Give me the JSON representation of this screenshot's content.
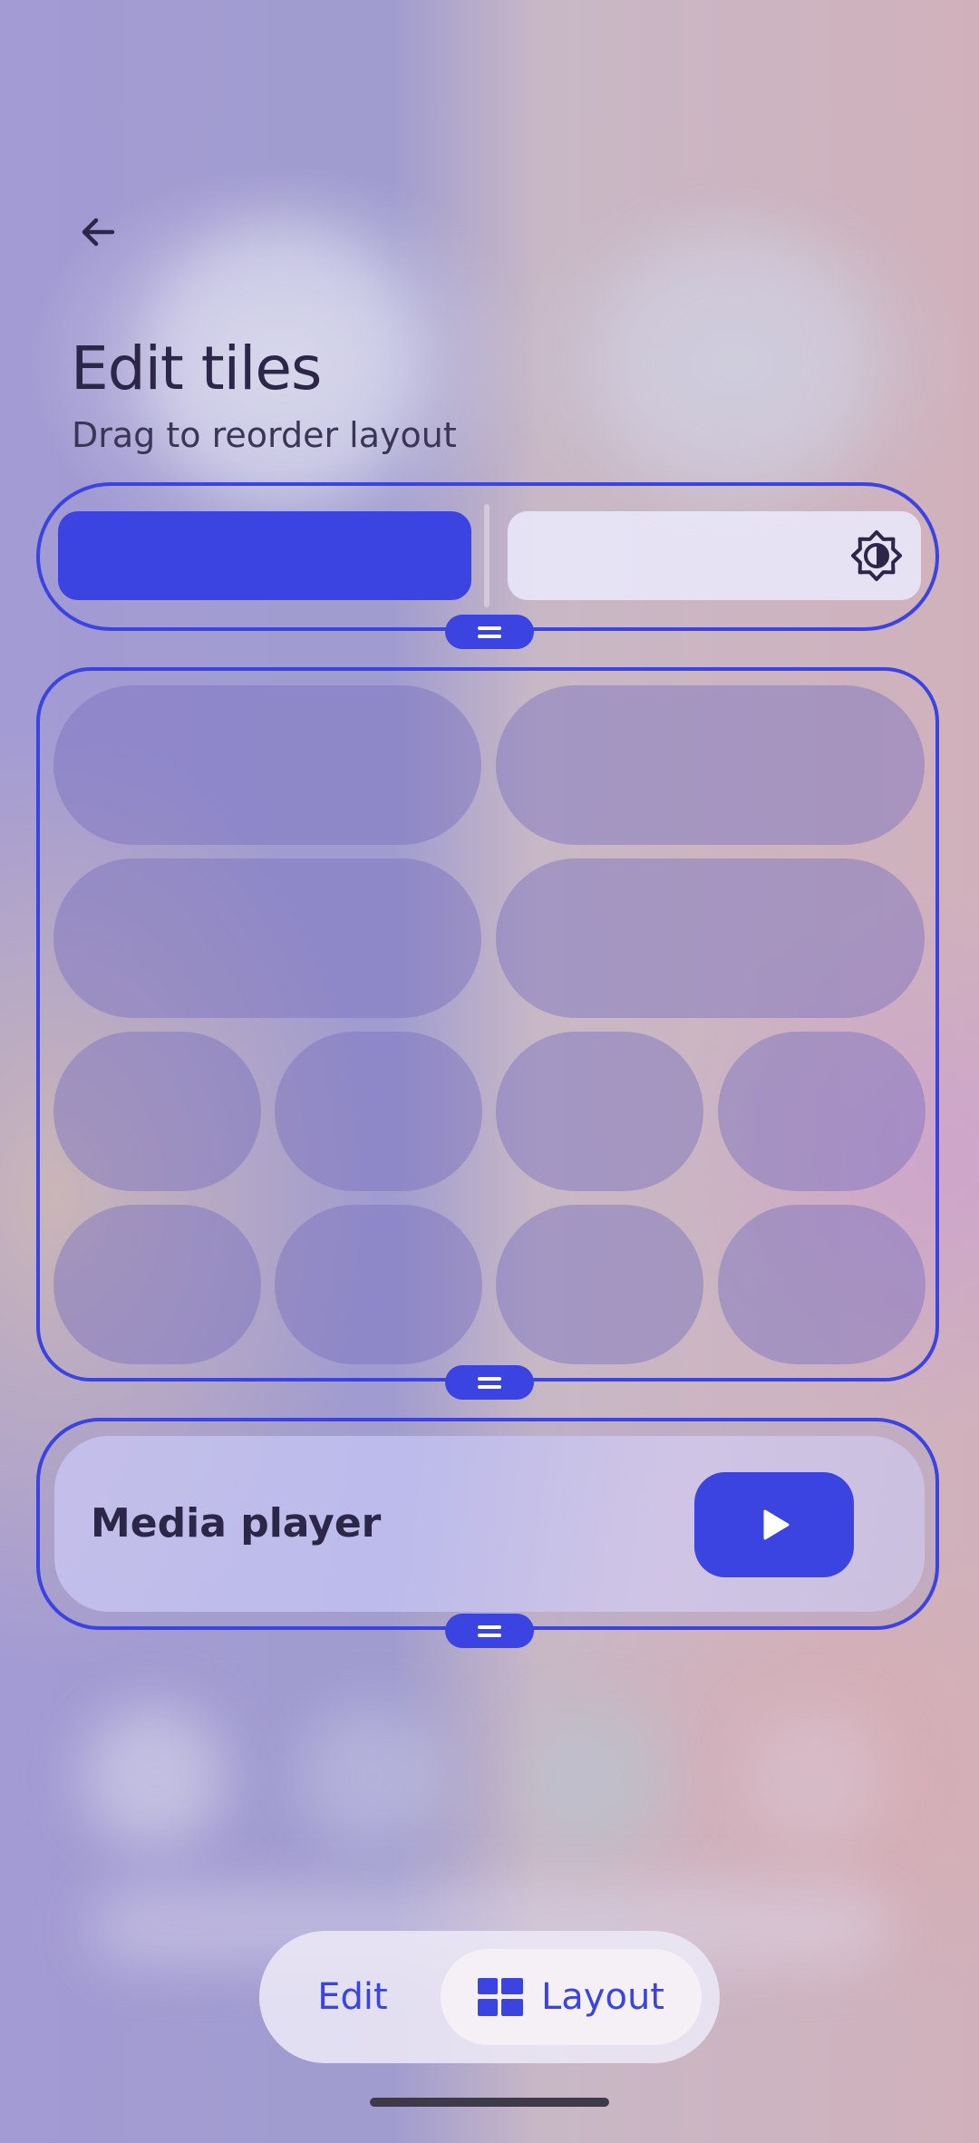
{
  "header": {
    "title": "Edit tiles",
    "subtitle": "Drag to reorder layout"
  },
  "icons": {
    "back": "arrow-back-icon",
    "brightness": "brightness-auto-icon",
    "play": "play-icon",
    "layout": "grid-layout-icon",
    "handle": "drag-handle-icon"
  },
  "media": {
    "label": "Media player"
  },
  "mode_toggle": {
    "edit_label": "Edit",
    "layout_label": "Layout",
    "selected": "Layout"
  },
  "colors": {
    "accent": "#3b44e0",
    "text_dark": "#2c2648"
  }
}
